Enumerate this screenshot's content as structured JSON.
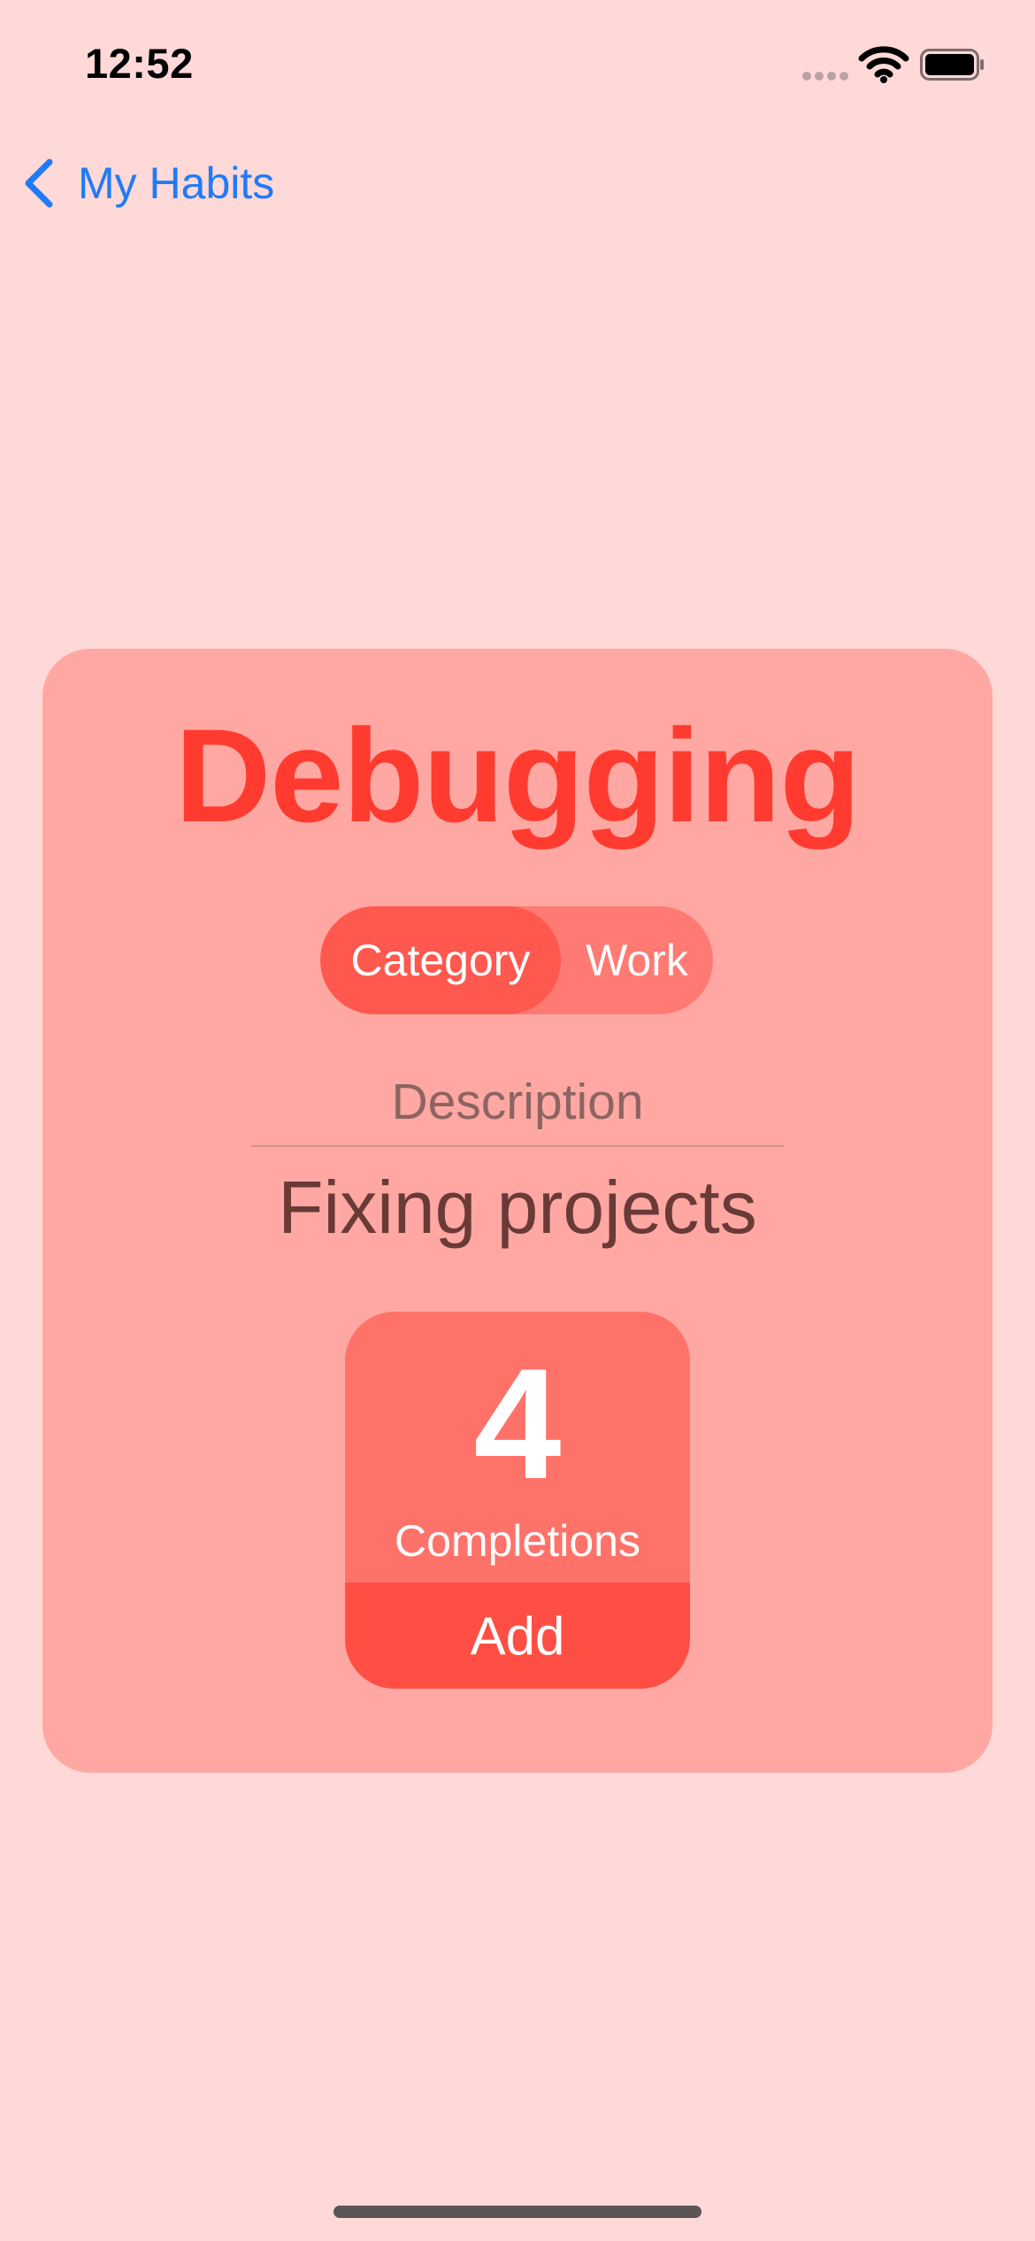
{
  "status_bar": {
    "time": "12:52"
  },
  "nav": {
    "back_label": "My Habits"
  },
  "habit": {
    "title": "Debugging",
    "category_key": "Category",
    "category_value": "Work",
    "description_label": "Description",
    "description_text": "Fixing projects",
    "completions_count": "4",
    "completions_label": "Completions",
    "add_label": "Add"
  },
  "colors": {
    "background": "#FFD9D8",
    "card": "#FFA8A3",
    "accent_red": "#FF3B30",
    "link_blue": "#1F7BF6"
  },
  "icons": {
    "back": "chevron-left-icon",
    "signal": "cellular-signal-icon",
    "wifi": "wifi-icon",
    "battery": "battery-icon"
  }
}
